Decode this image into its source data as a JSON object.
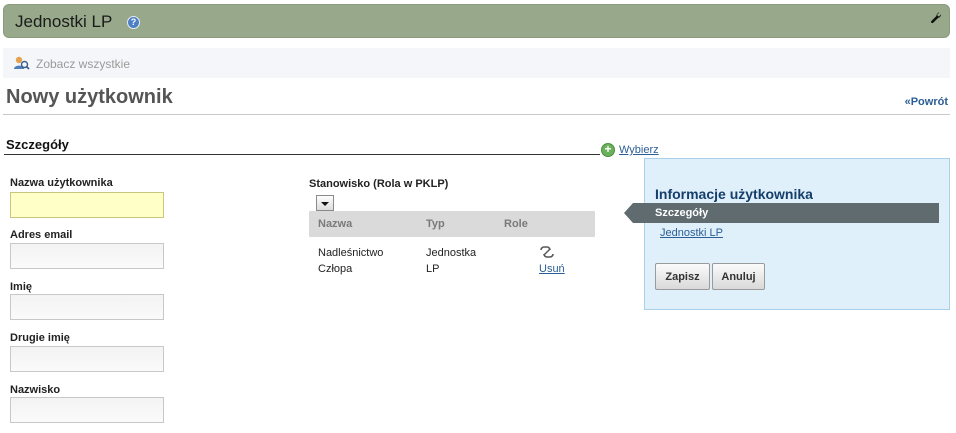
{
  "header": {
    "title": "Jednostki LP",
    "help_icon": "?",
    "tool_icon": "wrench-icon"
  },
  "subbar": {
    "view_all": "Zobacz wszystkie"
  },
  "page": {
    "title": "Nowy użytkownik",
    "back": "«Powrót"
  },
  "section": {
    "title": "Szczegóły",
    "choose": "Wybierz"
  },
  "form": {
    "fields": [
      {
        "label": "Nazwa użytkownika",
        "value": ""
      },
      {
        "label": "Adres email",
        "value": ""
      },
      {
        "label": "Imię",
        "value": ""
      },
      {
        "label": "Drugie imię",
        "value": ""
      },
      {
        "label": "Nazwisko",
        "value": ""
      }
    ]
  },
  "role": {
    "label": "Stanowisko (Rola w PKLP)",
    "columns": [
      "Nazwa",
      "Typ",
      "Role"
    ],
    "rows": [
      {
        "name_line1": "Nadleśnictwo",
        "name_line2": "Człopa",
        "type_line1": "Jednostka",
        "type_line2": "LP",
        "remove": "Usuń"
      }
    ]
  },
  "info": {
    "title": "Informacje użytkownika",
    "tab": "Szczegóły",
    "link": "Jednostki LP",
    "save": "Zapisz",
    "cancel": "Anuluj"
  }
}
